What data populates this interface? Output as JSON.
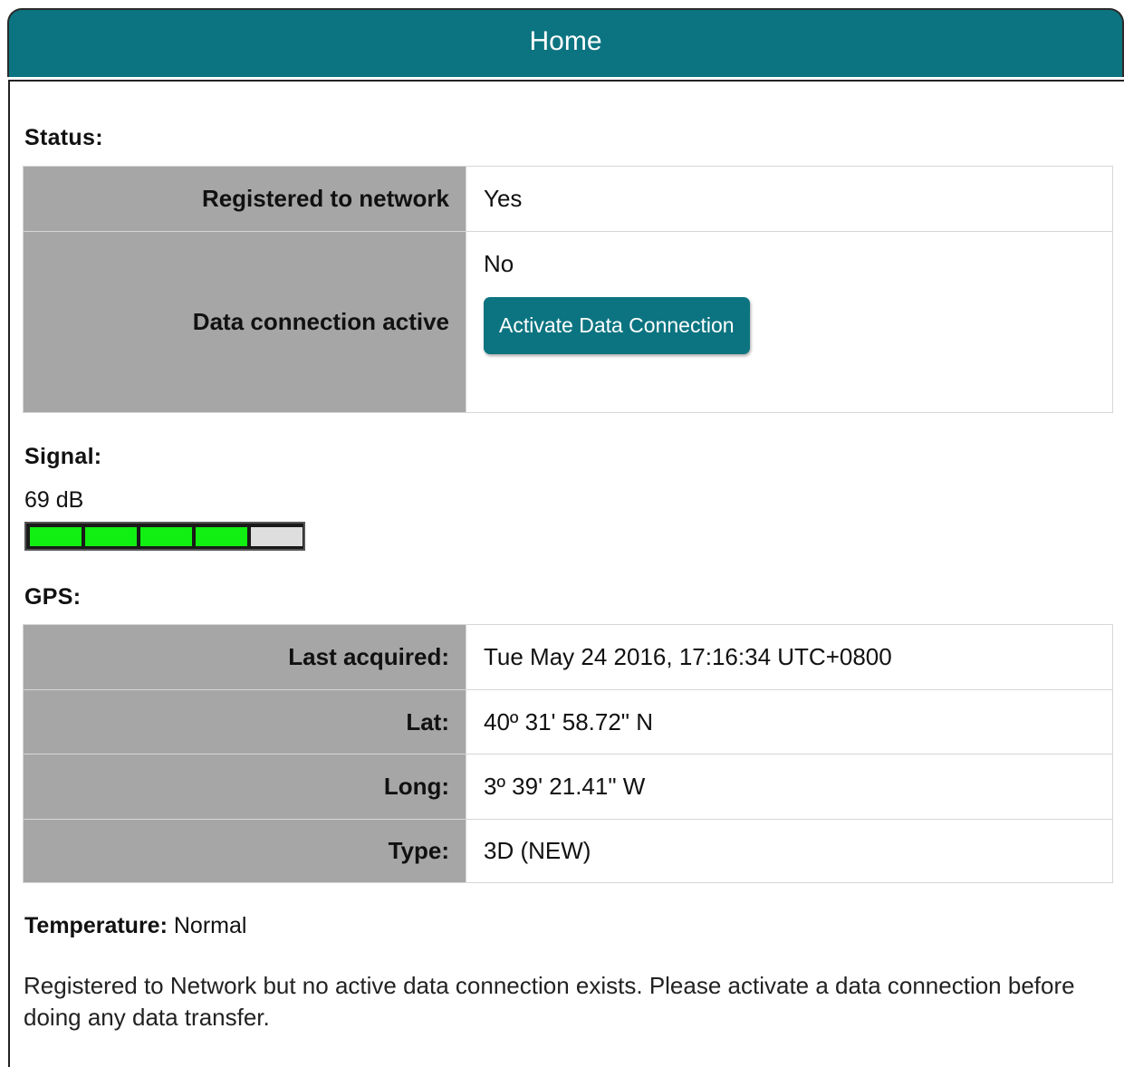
{
  "header": {
    "title": "Home"
  },
  "status": {
    "title": "Status:",
    "rows": [
      {
        "label": "Registered to network",
        "value": "Yes"
      },
      {
        "label": "Data connection active",
        "value": "No"
      }
    ],
    "activate_button_label": "Activate Data Connection"
  },
  "signal": {
    "title": "Signal:",
    "value_text": "69 dB",
    "bars_lit": 4,
    "bars_total": 5
  },
  "gps": {
    "title": "GPS:",
    "rows": [
      {
        "label": "Last acquired:",
        "value": "Tue May 24 2016, 17:16:34 UTC+0800"
      },
      {
        "label": "Lat:",
        "value": "40º 31' 58.72\" N"
      },
      {
        "label": "Long:",
        "value": "3º 39' 21.41\" W"
      },
      {
        "label": "Type:",
        "value": "3D (NEW)"
      }
    ]
  },
  "temperature": {
    "label": "Temperature:",
    "value": "Normal"
  },
  "message": "Registered to Network but no active data connection exists. Please activate a data connection before doing any data transfer.",
  "colors": {
    "accent": "#0c7481",
    "label_bg": "#a6a6a6",
    "signal_on": "#11ee11",
    "signal_off": "#dedede"
  }
}
